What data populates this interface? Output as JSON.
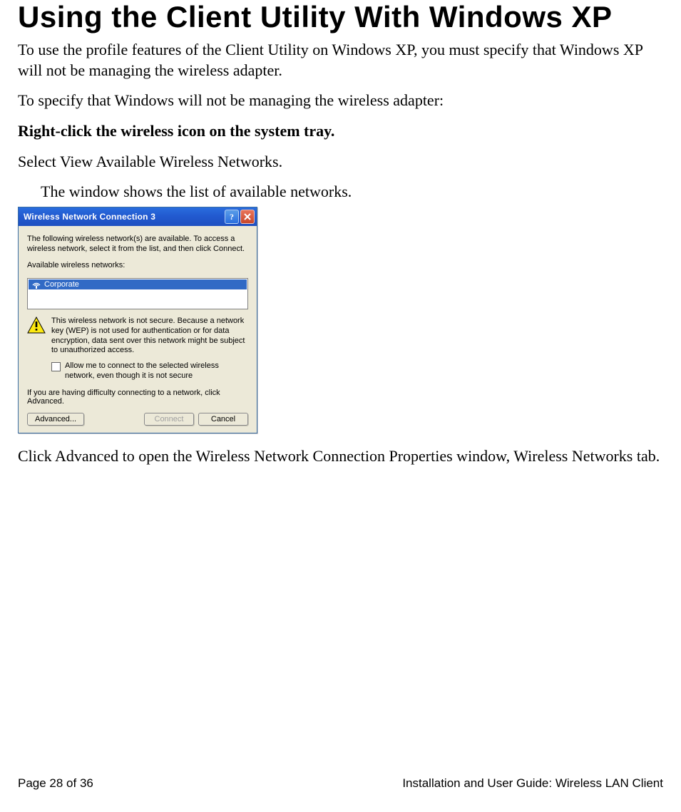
{
  "heading": "Using the Client Utility With Windows XP",
  "para1": "To use the profile features of the Client Utility on Windows XP, you must specify that Windows XP will not be managing the wireless adapter.",
  "para2": "To specify that Windows will not be managing the wireless adapter:",
  "step_bold": "Right-click the wireless icon on the system tray.",
  "step_select": "Select View Available Wireless Networks.",
  "step_result": "The window shows the list of available networks.",
  "dialog": {
    "title": "Wireless Network Connection 3",
    "intro": "The following wireless network(s) are available. To access a wireless network, select it from the list, and then click Connect.",
    "available_label": "Available wireless networks:",
    "network": "Corporate",
    "warning": "This wireless network is not secure. Because a network key (WEP) is not used for authentication or for data encryption, data sent over this network might be subject to unauthorized access.",
    "allow_label": "Allow me to connect to the selected wireless network, even though it is not secure",
    "advice": "If you are having difficulty connecting to a network, click Advanced.",
    "buttons": {
      "advanced": "Advanced...",
      "connect": "Connect",
      "cancel": "Cancel"
    }
  },
  "para3": "Click Advanced to open the Wireless Network Connection Properties window, Wireless Networks tab.",
  "footer": {
    "page": "Page 28 of 36",
    "guide": "Installation and User Guide: Wireless LAN Client"
  }
}
